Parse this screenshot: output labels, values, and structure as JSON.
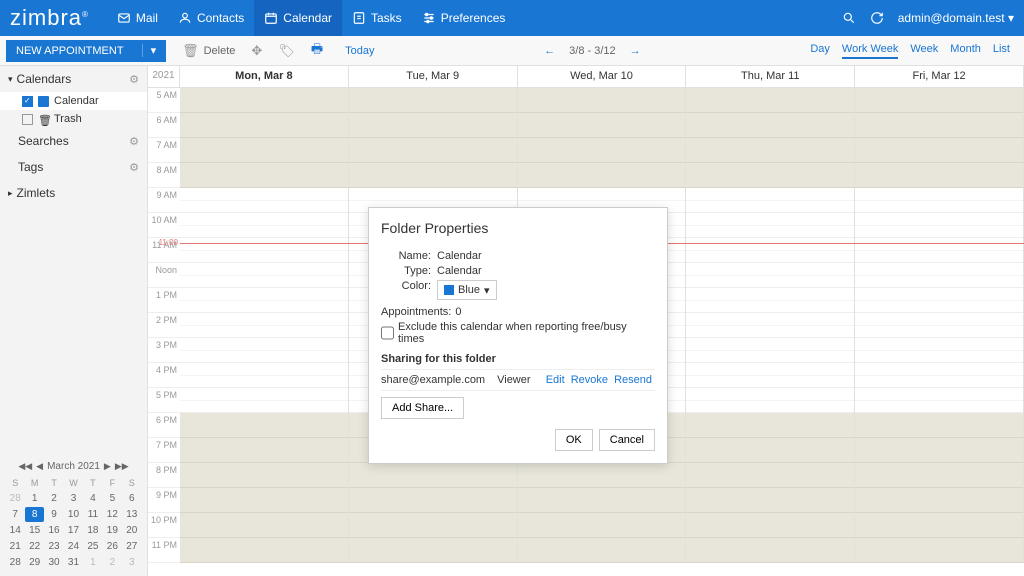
{
  "header": {
    "logo": "zimbra",
    "tabs": [
      {
        "label": "Mail",
        "icon": "mail"
      },
      {
        "label": "Contacts",
        "icon": "contacts"
      },
      {
        "label": "Calendar",
        "icon": "calendar",
        "active": true
      },
      {
        "label": "Tasks",
        "icon": "tasks"
      },
      {
        "label": "Preferences",
        "icon": "prefs"
      }
    ],
    "user": "admin@domain.test"
  },
  "toolbar": {
    "new_label": "NEW APPOINTMENT",
    "delete_label": "Delete",
    "today_label": "Today",
    "date_range": "3/8 - 3/12",
    "views": [
      "Day",
      "Work Week",
      "Week",
      "Month",
      "List"
    ],
    "active_view": "Work Week"
  },
  "sidebar": {
    "calendars_label": "Calendars",
    "items": [
      {
        "label": "Calendar",
        "checked": true
      },
      {
        "label": "Trash",
        "checked": false
      }
    ],
    "searches_label": "Searches",
    "tags_label": "Tags",
    "zimlets_label": "Zimlets"
  },
  "cal": {
    "year": "2021",
    "days": [
      "Mon, Mar 8",
      "Tue, Mar 9",
      "Wed, Mar 10",
      "Thu, Mar 11",
      "Fri, Mar 12"
    ],
    "hours": [
      "5 AM",
      "6 AM",
      "7 AM",
      "8 AM",
      "9 AM",
      "10 AM",
      "11 AM",
      "Noon",
      "1 PM",
      "2 PM",
      "3 PM",
      "4 PM",
      "5 PM",
      "6 PM",
      "7 PM",
      "8 PM",
      "9 PM",
      "10 PM",
      "11 PM"
    ]
  },
  "mini": {
    "title": "March 2021",
    "dow": [
      "S",
      "M",
      "T",
      "W",
      "T",
      "F",
      "S"
    ],
    "weeks": [
      [
        "28",
        "1",
        "2",
        "3",
        "4",
        "5",
        "6"
      ],
      [
        "7",
        "8",
        "9",
        "10",
        "11",
        "12",
        "13"
      ],
      [
        "14",
        "15",
        "16",
        "17",
        "18",
        "19",
        "20"
      ],
      [
        "21",
        "22",
        "23",
        "24",
        "25",
        "26",
        "27"
      ],
      [
        "28",
        "29",
        "30",
        "31",
        "1",
        "2",
        "3"
      ]
    ],
    "today": "8"
  },
  "dialog": {
    "title": "Folder Properties",
    "name_label": "Name:",
    "name_value": "Calendar",
    "type_label": "Type:",
    "type_value": "Calendar",
    "color_label": "Color:",
    "color_value": "Blue",
    "appointments_label": "Appointments:",
    "appointments_value": "0",
    "exclude_label": "Exclude this calendar when reporting free/busy times",
    "sharing_label": "Sharing for this folder",
    "share_email": "share@example.com",
    "share_role": "Viewer",
    "action_edit": "Edit",
    "action_revoke": "Revoke",
    "action_resend": "Resend",
    "add_share_label": "Add Share...",
    "ok_label": "OK",
    "cancel_label": "Cancel"
  }
}
